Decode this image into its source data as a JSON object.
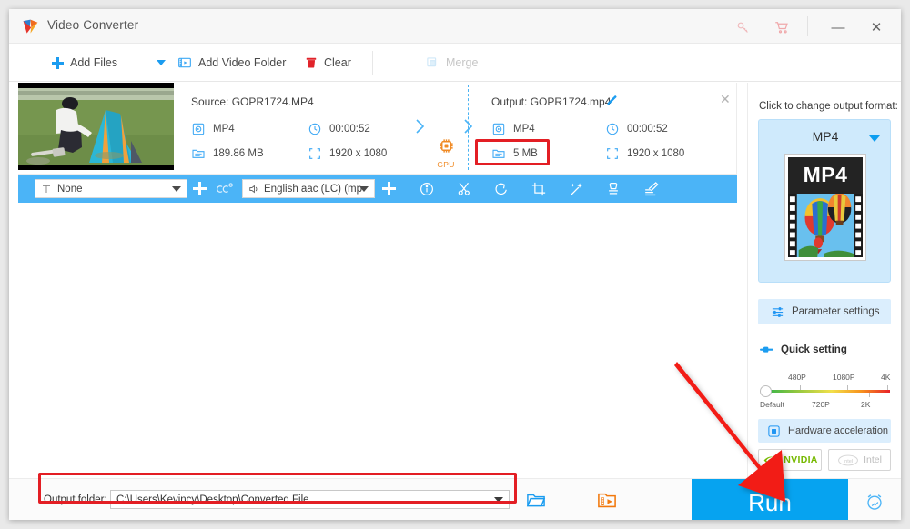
{
  "window": {
    "title": "Video Converter",
    "controls": {
      "key": "key-icon",
      "cart": "cart-icon",
      "minimize": "—",
      "close": "✕"
    }
  },
  "toolbar": {
    "add_files": "Add Files",
    "add_video_folder": "Add Video Folder",
    "clear": "Clear",
    "merge": "Merge",
    "merge_enabled": false
  },
  "file_card": {
    "source_label": "Source: GOPR1724.MP4",
    "source_format": "MP4",
    "source_duration": "00:00:52",
    "source_size": "189.86 MB",
    "source_resolution": "1920 x 1080",
    "output_label": "Output: GOPR1724.mp4",
    "output_format": "MP4",
    "output_duration": "00:00:52",
    "output_size": "5 MB",
    "output_resolution": "1920 x 1080",
    "gpu_badge": "GPU",
    "close": "✕",
    "highlight_color": "#e31e24"
  },
  "action_bar": {
    "subtitle_value": "None",
    "audio_value": "English aac (LC) (mp",
    "tools": [
      {
        "name": "info-icon",
        "title": "Information"
      },
      {
        "name": "trim-icon",
        "title": "Trim"
      },
      {
        "name": "rotate-icon",
        "title": "Rotate"
      },
      {
        "name": "crop-icon",
        "title": "Crop"
      },
      {
        "name": "effect-icon",
        "title": "Effect"
      },
      {
        "name": "watermark-icon",
        "title": "Watermark"
      },
      {
        "name": "subtitle-edit-icon",
        "title": "Subtitle"
      }
    ]
  },
  "right_panel": {
    "title": "Click to change output format:",
    "format_name": "MP4",
    "format_thumb_text": "MP4",
    "parameter_settings": "Parameter settings",
    "quick_setting": "Quick setting",
    "slider": {
      "top_labels": [
        "480P",
        "1080P",
        "4K"
      ],
      "bottom_labels": [
        "Default",
        "720P",
        "2K"
      ],
      "value": "Default"
    },
    "hardware_acceleration": "Hardware acceleration",
    "nvidia": "NVIDIA",
    "intel": "Intel",
    "intel_enabled": false
  },
  "bottom_bar": {
    "output_folder_label": "Output folder:",
    "output_folder_value": "C:\\Users\\Kevincy\\Desktop\\Converted File",
    "browse_icon": "folder-icon",
    "open_output_icon": "open-output-folder-icon",
    "run_label": "Run",
    "alarm_icon": "alarm-clock-icon"
  },
  "colors": {
    "accent": "#06a3f0",
    "blue_bar": "#4bb4f7",
    "highlight": "#e31e24",
    "panel_blue": "#cfeafc",
    "nvidia_green": "#76b900",
    "gpu_orange": "#f08a24"
  }
}
